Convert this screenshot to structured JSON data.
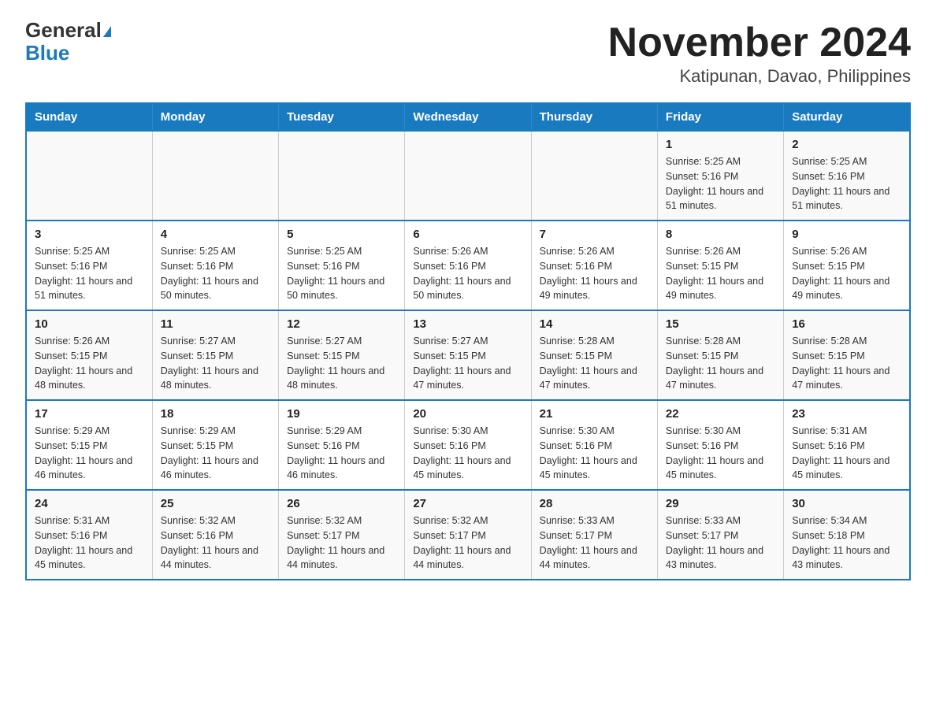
{
  "header": {
    "logo_general": "General",
    "logo_blue": "Blue",
    "title": "November 2024",
    "subtitle": "Katipunan, Davao, Philippines"
  },
  "weekdays": [
    "Sunday",
    "Monday",
    "Tuesday",
    "Wednesday",
    "Thursday",
    "Friday",
    "Saturday"
  ],
  "weeks": [
    [
      {
        "day": "",
        "sunrise": "",
        "sunset": "",
        "daylight": ""
      },
      {
        "day": "",
        "sunrise": "",
        "sunset": "",
        "daylight": ""
      },
      {
        "day": "",
        "sunrise": "",
        "sunset": "",
        "daylight": ""
      },
      {
        "day": "",
        "sunrise": "",
        "sunset": "",
        "daylight": ""
      },
      {
        "day": "",
        "sunrise": "",
        "sunset": "",
        "daylight": ""
      },
      {
        "day": "1",
        "sunrise": "Sunrise: 5:25 AM",
        "sunset": "Sunset: 5:16 PM",
        "daylight": "Daylight: 11 hours and 51 minutes."
      },
      {
        "day": "2",
        "sunrise": "Sunrise: 5:25 AM",
        "sunset": "Sunset: 5:16 PM",
        "daylight": "Daylight: 11 hours and 51 minutes."
      }
    ],
    [
      {
        "day": "3",
        "sunrise": "Sunrise: 5:25 AM",
        "sunset": "Sunset: 5:16 PM",
        "daylight": "Daylight: 11 hours and 51 minutes."
      },
      {
        "day": "4",
        "sunrise": "Sunrise: 5:25 AM",
        "sunset": "Sunset: 5:16 PM",
        "daylight": "Daylight: 11 hours and 50 minutes."
      },
      {
        "day": "5",
        "sunrise": "Sunrise: 5:25 AM",
        "sunset": "Sunset: 5:16 PM",
        "daylight": "Daylight: 11 hours and 50 minutes."
      },
      {
        "day": "6",
        "sunrise": "Sunrise: 5:26 AM",
        "sunset": "Sunset: 5:16 PM",
        "daylight": "Daylight: 11 hours and 50 minutes."
      },
      {
        "day": "7",
        "sunrise": "Sunrise: 5:26 AM",
        "sunset": "Sunset: 5:16 PM",
        "daylight": "Daylight: 11 hours and 49 minutes."
      },
      {
        "day": "8",
        "sunrise": "Sunrise: 5:26 AM",
        "sunset": "Sunset: 5:15 PM",
        "daylight": "Daylight: 11 hours and 49 minutes."
      },
      {
        "day": "9",
        "sunrise": "Sunrise: 5:26 AM",
        "sunset": "Sunset: 5:15 PM",
        "daylight": "Daylight: 11 hours and 49 minutes."
      }
    ],
    [
      {
        "day": "10",
        "sunrise": "Sunrise: 5:26 AM",
        "sunset": "Sunset: 5:15 PM",
        "daylight": "Daylight: 11 hours and 48 minutes."
      },
      {
        "day": "11",
        "sunrise": "Sunrise: 5:27 AM",
        "sunset": "Sunset: 5:15 PM",
        "daylight": "Daylight: 11 hours and 48 minutes."
      },
      {
        "day": "12",
        "sunrise": "Sunrise: 5:27 AM",
        "sunset": "Sunset: 5:15 PM",
        "daylight": "Daylight: 11 hours and 48 minutes."
      },
      {
        "day": "13",
        "sunrise": "Sunrise: 5:27 AM",
        "sunset": "Sunset: 5:15 PM",
        "daylight": "Daylight: 11 hours and 47 minutes."
      },
      {
        "day": "14",
        "sunrise": "Sunrise: 5:28 AM",
        "sunset": "Sunset: 5:15 PM",
        "daylight": "Daylight: 11 hours and 47 minutes."
      },
      {
        "day": "15",
        "sunrise": "Sunrise: 5:28 AM",
        "sunset": "Sunset: 5:15 PM",
        "daylight": "Daylight: 11 hours and 47 minutes."
      },
      {
        "day": "16",
        "sunrise": "Sunrise: 5:28 AM",
        "sunset": "Sunset: 5:15 PM",
        "daylight": "Daylight: 11 hours and 47 minutes."
      }
    ],
    [
      {
        "day": "17",
        "sunrise": "Sunrise: 5:29 AM",
        "sunset": "Sunset: 5:15 PM",
        "daylight": "Daylight: 11 hours and 46 minutes."
      },
      {
        "day": "18",
        "sunrise": "Sunrise: 5:29 AM",
        "sunset": "Sunset: 5:15 PM",
        "daylight": "Daylight: 11 hours and 46 minutes."
      },
      {
        "day": "19",
        "sunrise": "Sunrise: 5:29 AM",
        "sunset": "Sunset: 5:16 PM",
        "daylight": "Daylight: 11 hours and 46 minutes."
      },
      {
        "day": "20",
        "sunrise": "Sunrise: 5:30 AM",
        "sunset": "Sunset: 5:16 PM",
        "daylight": "Daylight: 11 hours and 45 minutes."
      },
      {
        "day": "21",
        "sunrise": "Sunrise: 5:30 AM",
        "sunset": "Sunset: 5:16 PM",
        "daylight": "Daylight: 11 hours and 45 minutes."
      },
      {
        "day": "22",
        "sunrise": "Sunrise: 5:30 AM",
        "sunset": "Sunset: 5:16 PM",
        "daylight": "Daylight: 11 hours and 45 minutes."
      },
      {
        "day": "23",
        "sunrise": "Sunrise: 5:31 AM",
        "sunset": "Sunset: 5:16 PM",
        "daylight": "Daylight: 11 hours and 45 minutes."
      }
    ],
    [
      {
        "day": "24",
        "sunrise": "Sunrise: 5:31 AM",
        "sunset": "Sunset: 5:16 PM",
        "daylight": "Daylight: 11 hours and 45 minutes."
      },
      {
        "day": "25",
        "sunrise": "Sunrise: 5:32 AM",
        "sunset": "Sunset: 5:16 PM",
        "daylight": "Daylight: 11 hours and 44 minutes."
      },
      {
        "day": "26",
        "sunrise": "Sunrise: 5:32 AM",
        "sunset": "Sunset: 5:17 PM",
        "daylight": "Daylight: 11 hours and 44 minutes."
      },
      {
        "day": "27",
        "sunrise": "Sunrise: 5:32 AM",
        "sunset": "Sunset: 5:17 PM",
        "daylight": "Daylight: 11 hours and 44 minutes."
      },
      {
        "day": "28",
        "sunrise": "Sunrise: 5:33 AM",
        "sunset": "Sunset: 5:17 PM",
        "daylight": "Daylight: 11 hours and 44 minutes."
      },
      {
        "day": "29",
        "sunrise": "Sunrise: 5:33 AM",
        "sunset": "Sunset: 5:17 PM",
        "daylight": "Daylight: 11 hours and 43 minutes."
      },
      {
        "day": "30",
        "sunrise": "Sunrise: 5:34 AM",
        "sunset": "Sunset: 5:18 PM",
        "daylight": "Daylight: 11 hours and 43 minutes."
      }
    ]
  ]
}
